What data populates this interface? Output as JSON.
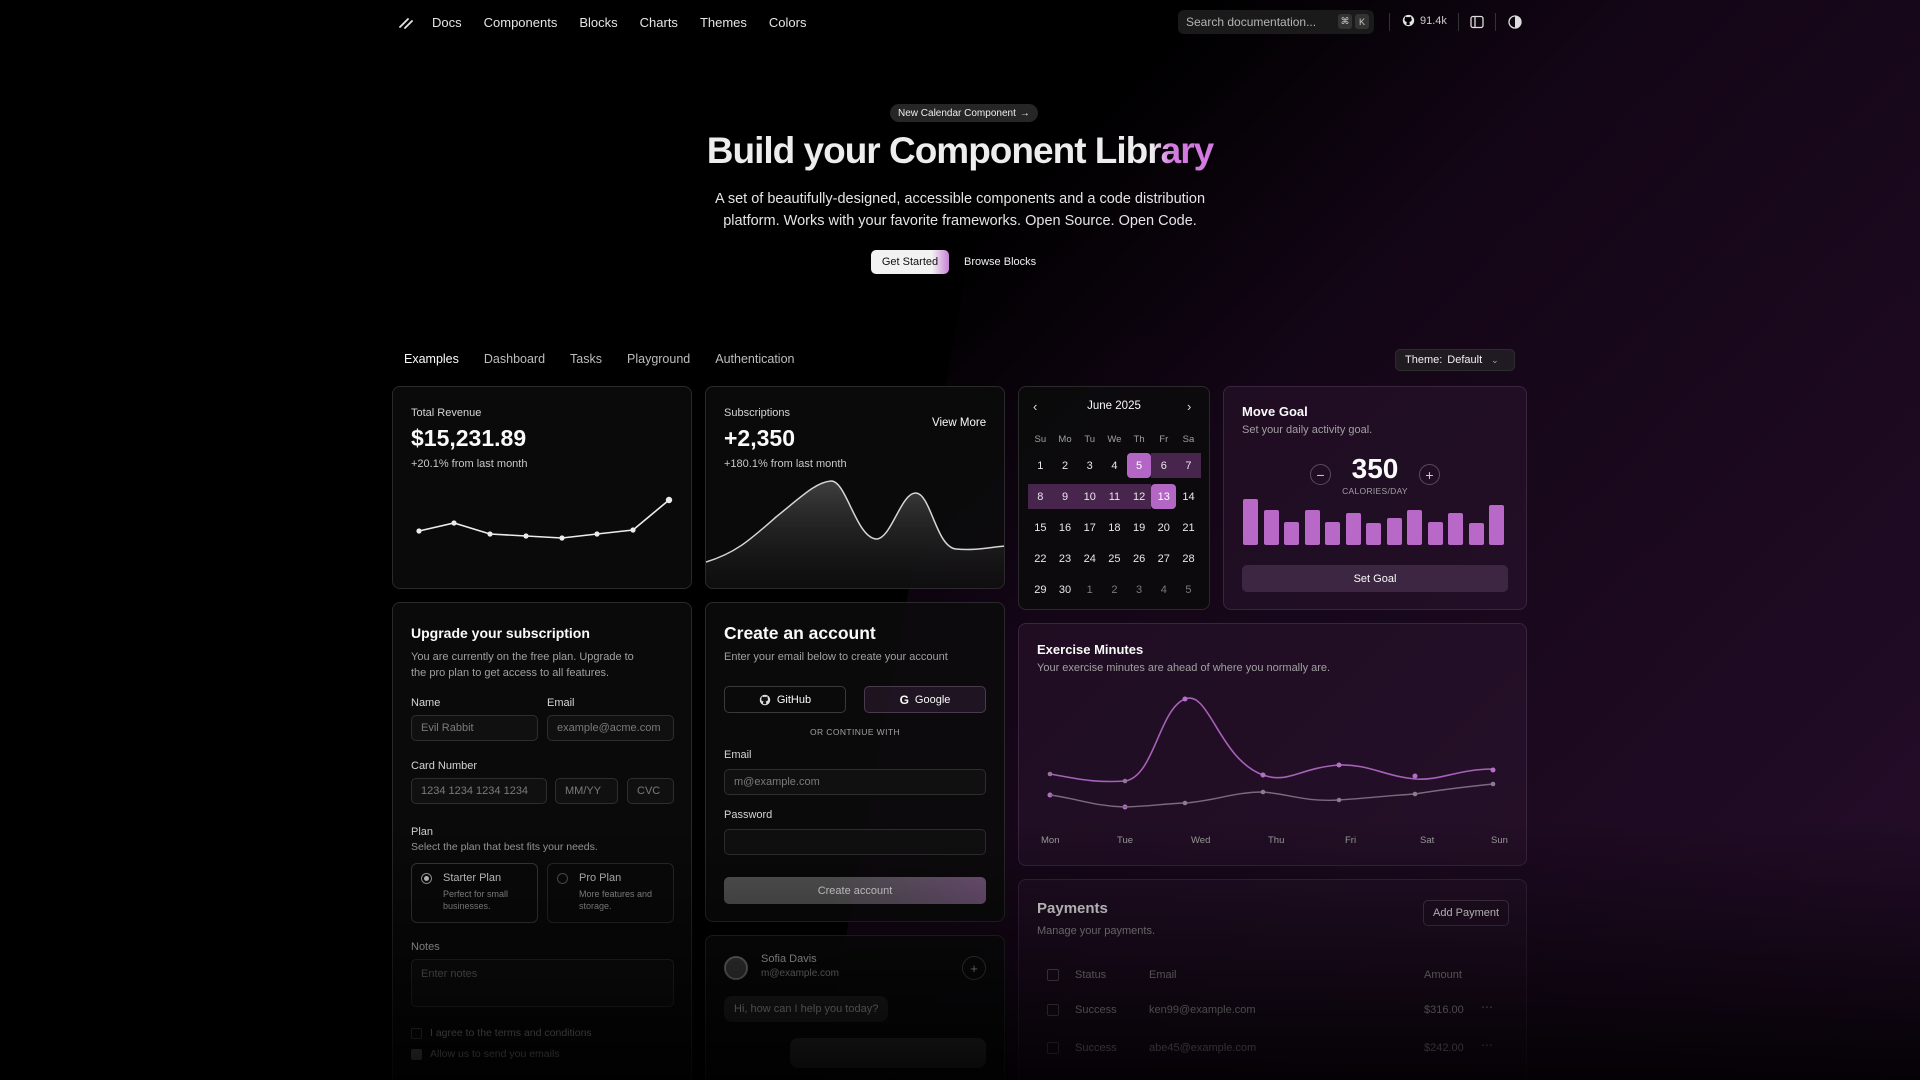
{
  "nav": {
    "links": [
      "Docs",
      "Components",
      "Blocks",
      "Charts",
      "Themes",
      "Colors"
    ],
    "search_placeholder": "Search documentation...",
    "kbd1": "⌘",
    "kbd2": "K",
    "github_stars": "91.4k"
  },
  "hero": {
    "pill": "New Calendar Component",
    "title": "Build your Component Library",
    "subtitle": "A set of beautifully-designed, accessible components and a code distribution platform. Works with your favorite frameworks. Open Source. Open Code.",
    "primary_cta": "Get Started",
    "secondary_cta": "Browse Blocks"
  },
  "tabs": {
    "items": [
      "Examples",
      "Dashboard",
      "Tasks",
      "Playground",
      "Authentication"
    ],
    "active": "Examples",
    "theme_label": "Theme:",
    "theme_value": "Default"
  },
  "revenue": {
    "label": "Total Revenue",
    "value": "$15,231.89",
    "delta": "+20.1% from last month"
  },
  "subscriptions": {
    "label": "Subscriptions",
    "value": "+2,350",
    "delta": "+180.1% from last month",
    "view_more": "View More"
  },
  "calendar": {
    "month": "June 2025",
    "dow": [
      "Su",
      "Mo",
      "Tu",
      "We",
      "Th",
      "Fr",
      "Sa"
    ],
    "weeks": [
      [
        "1",
        "2",
        "3",
        "4",
        "5",
        "6",
        "7"
      ],
      [
        "8",
        "9",
        "10",
        "11",
        "12",
        "13",
        "14"
      ],
      [
        "15",
        "16",
        "17",
        "18",
        "19",
        "20",
        "21"
      ],
      [
        "22",
        "23",
        "24",
        "25",
        "26",
        "27",
        "28"
      ],
      [
        "29",
        "30",
        "1",
        "2",
        "3",
        "4",
        "5"
      ]
    ],
    "selected_start": "5",
    "selected_end": "13"
  },
  "move_goal": {
    "title": "Move Goal",
    "subtitle": "Set your daily activity goal.",
    "value": "350",
    "unit": "CALORIES/DAY",
    "button": "Set Goal",
    "bars": [
      400,
      300,
      200,
      300,
      200,
      278,
      189,
      239,
      300,
      200,
      278,
      189,
      349
    ]
  },
  "upgrade": {
    "title": "Upgrade your subscription",
    "subtitle": "You are currently on the free plan. Upgrade to the pro plan to get access to all features.",
    "name_label": "Name",
    "name_placeholder": "Evil Rabbit",
    "email_label": "Email",
    "email_placeholder": "example@acme.com",
    "card_label": "Card Number",
    "card_placeholder": "1234 1234 1234 1234",
    "exp_placeholder": "MM/YY",
    "cvc_placeholder": "CVC",
    "plan_label": "Plan",
    "plan_sub": "Select the plan that best fits your needs.",
    "starter": "Starter Plan",
    "starter_desc": "Perfect for small businesses.",
    "pro": "Pro Plan",
    "pro_desc": "More features and storage.",
    "notes_label": "Notes",
    "notes_placeholder": "Enter notes",
    "terms": "I agree to the terms and conditions",
    "emails": "Allow us to send you emails"
  },
  "create_account": {
    "title": "Create an account",
    "subtitle": "Enter your email below to create your account",
    "github": "GitHub",
    "google": "Google",
    "divider": "OR CONTINUE WITH",
    "email_label": "Email",
    "email_placeholder": "m@example.com",
    "password_label": "Password",
    "button": "Create account"
  },
  "chat": {
    "name": "Sofia Davis",
    "email": "m@example.com",
    "message": "Hi, how can I help you today?"
  },
  "exercise": {
    "title": "Exercise Minutes",
    "subtitle": "Your exercise minutes are ahead of where you normally are.",
    "days": [
      "Mon",
      "Tue",
      "Wed",
      "Thu",
      "Fri",
      "Sat",
      "Sun"
    ]
  },
  "payments": {
    "title": "Payments",
    "subtitle": "Manage your payments.",
    "add_button": "Add Payment",
    "columns": [
      "Status",
      "Email",
      "Amount"
    ],
    "rows": [
      {
        "status": "Success",
        "email": "ken99@example.com",
        "amount": "$316.00"
      },
      {
        "status": "Success",
        "email": "abe45@example.com",
        "amount": "$242.00"
      }
    ]
  },
  "colors": {
    "accent": "#c77dd6",
    "selected_day": "#b466c4",
    "bar": "#b869c8"
  }
}
